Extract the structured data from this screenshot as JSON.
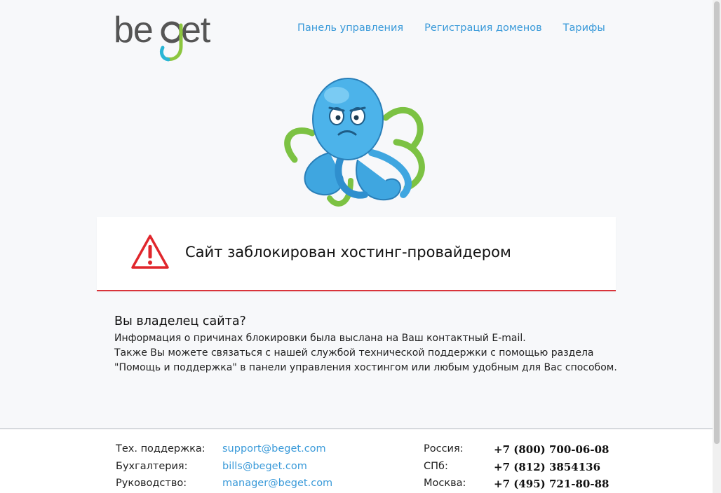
{
  "header": {
    "logo_text": "beget",
    "nav": [
      {
        "label": "Панель управления"
      },
      {
        "label": "Регистрация доменов"
      },
      {
        "label": "Тарифы"
      }
    ]
  },
  "alert": {
    "title": "Сайт заблокирован хостинг-провайдером"
  },
  "owner": {
    "heading": "Вы владелец сайта?",
    "lines": [
      "Информация о причинах блокировки была выслана на Ваш контактный E-mail.",
      "Также Вы можете связаться с нашей службой технической поддержки с помощью раздела",
      "\"Помощь и поддержка\" в панели управления хостингом или любым удобным для Вас способом."
    ]
  },
  "footer": {
    "rows": [
      {
        "label": "Тех. поддержка:",
        "email": "support@beget.com",
        "city": "Россия:",
        "phone": "+7 (800) 700-06-08"
      },
      {
        "label": "Бухгалтерия:",
        "email": "bills@beget.com",
        "city": "СПб:",
        "phone": "+7 (812) 3854136"
      },
      {
        "label": "Руководство:",
        "email": "manager@beget.com",
        "city": "Москва:",
        "phone": "+7 (495) 721-80-88"
      }
    ]
  },
  "colors": {
    "link": "#3a9ad9",
    "alert_red": "#d9343a",
    "logo_gray": "#555555",
    "logo_green": "#8cc63f"
  }
}
